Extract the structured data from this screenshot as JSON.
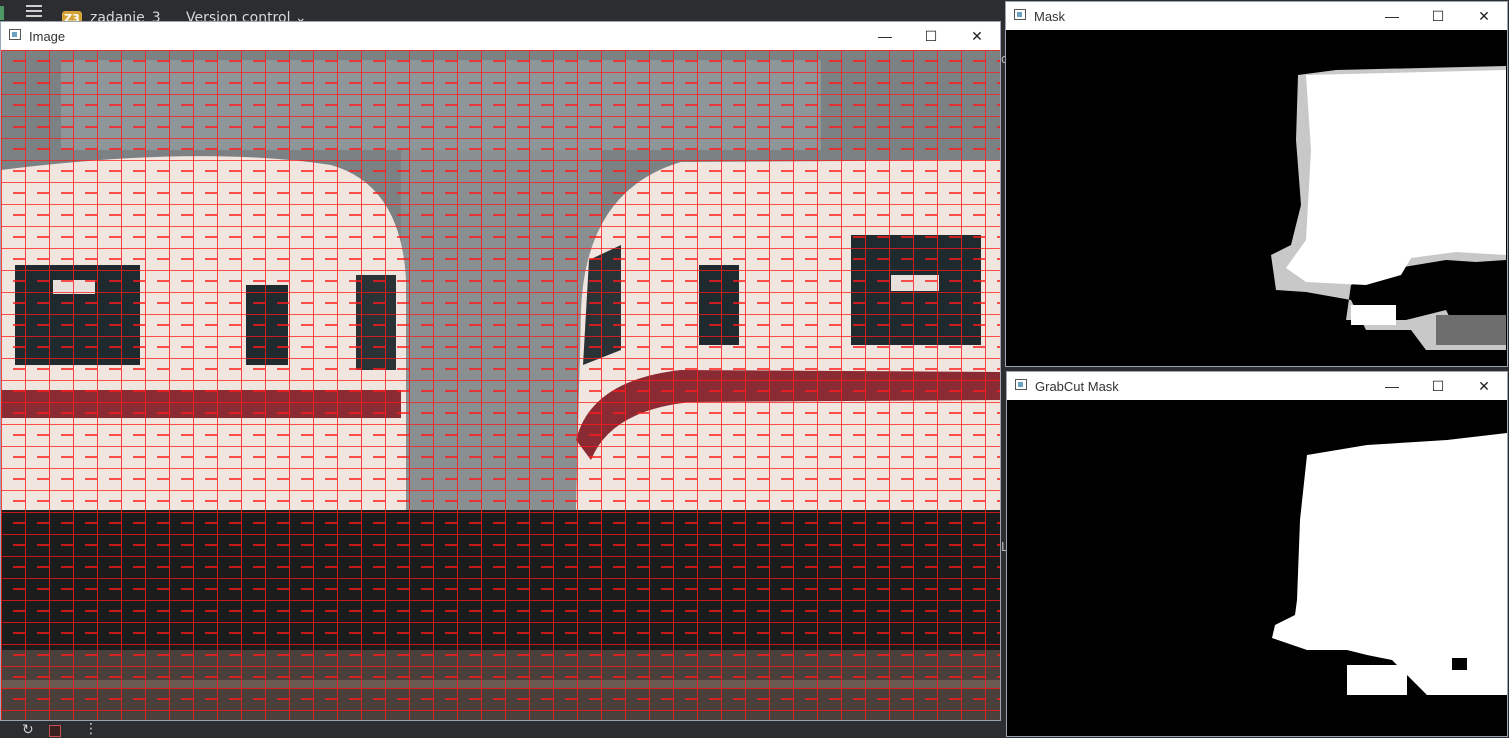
{
  "ide": {
    "project_badge": "Z3",
    "project_name": "zadanie_3",
    "vcs_label": "Version control",
    "side_glyph_top": "d",
    "side_glyph_bottom": "L",
    "more_label": "⋮"
  },
  "windows": {
    "image": {
      "title": "Image"
    },
    "mask": {
      "title": "Mask"
    },
    "grabcut": {
      "title": "GrabCut Mask"
    }
  },
  "controls": {
    "minimize": "—",
    "maximize": "☐",
    "close": "✕"
  },
  "colors": {
    "superpixel_boundary": "#ff1a1a",
    "train_body": "#f1e6df",
    "train_stripe": "#8a2a32",
    "mask_background": "#000000",
    "mask_foreground": "#ffffff",
    "mask_probable": "#c8c8c8",
    "mask_dark_gray": "#6e6e6e"
  }
}
